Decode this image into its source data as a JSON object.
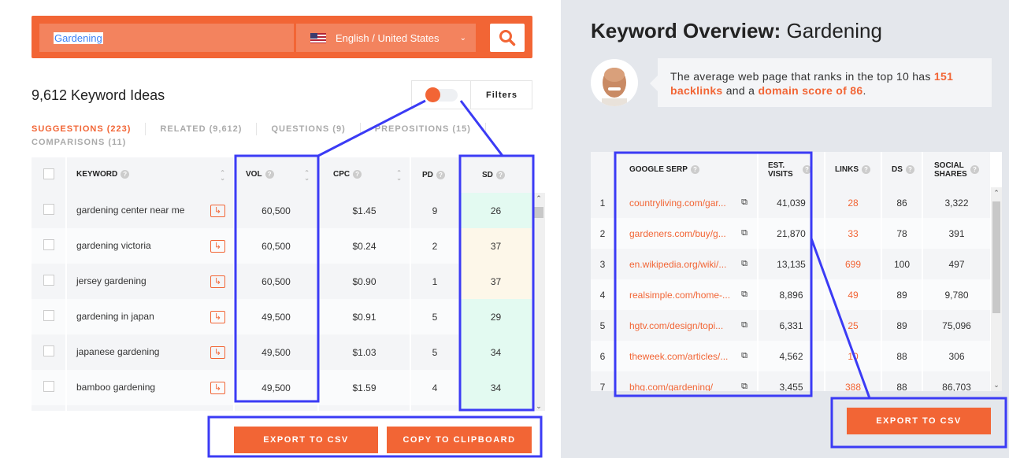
{
  "search": {
    "keyword": "Gardening",
    "language": "English / United States",
    "search_icon": "magnifier-icon",
    "flag_icon": "us-flag-icon"
  },
  "ideas_count": "9,612 Keyword Ideas",
  "filters_label": "Filters",
  "tabs": [
    {
      "label": "SUGGESTIONS (223)",
      "active": true
    },
    {
      "label": "RELATED (9,612)"
    },
    {
      "label": "QUESTIONS (9)"
    },
    {
      "label": "PREPOSITIONS (15)"
    },
    {
      "label": "COMPARISONS (11)"
    }
  ],
  "keywords_table": {
    "headers": [
      "KEYWORD",
      "VOL",
      "CPC",
      "PD",
      "SD"
    ],
    "rows": [
      {
        "keyword": "gardening center near me",
        "vol": "60,500",
        "cpc": "$1.45",
        "pd": "9",
        "sd": "26"
      },
      {
        "keyword": "gardening victoria",
        "vol": "60,500",
        "cpc": "$0.24",
        "pd": "2",
        "sd": "37"
      },
      {
        "keyword": "jersey gardening",
        "vol": "60,500",
        "cpc": "$0.90",
        "pd": "1",
        "sd": "37"
      },
      {
        "keyword": "gardening in japan",
        "vol": "49,500",
        "cpc": "$0.91",
        "pd": "5",
        "sd": "29"
      },
      {
        "keyword": "japanese gardening",
        "vol": "49,500",
        "cpc": "$1.03",
        "pd": "5",
        "sd": "34"
      },
      {
        "keyword": "bamboo gardening",
        "vol": "49,500",
        "cpc": "$1.59",
        "pd": "4",
        "sd": "34"
      }
    ]
  },
  "buttons": {
    "export_left": "EXPORT TO CSV",
    "copy": "COPY TO CLIPBOARD",
    "export_right": "EXPORT TO CSV"
  },
  "overview": {
    "title_bold": "Keyword Overview:",
    "title_keyword": "Gardening",
    "tip_prefix": "The average web page that ranks in the top 10 has ",
    "tip_backlinks": "151 backlinks",
    "tip_mid": " and a ",
    "tip_ds": "domain score of 86",
    "tip_end": "."
  },
  "serp_table": {
    "headers": [
      "GOOGLE SERP",
      "EST. VISITS",
      "LINKS",
      "DS",
      "SOCIAL SHARES"
    ],
    "rows": [
      {
        "rank": "1",
        "url": "countryliving.com/gar...",
        "visits": "41,039",
        "links": "28",
        "ds": "86",
        "shares": "3,322"
      },
      {
        "rank": "2",
        "url": "gardeners.com/buy/g...",
        "visits": "21,870",
        "links": "33",
        "ds": "78",
        "shares": "391"
      },
      {
        "rank": "3",
        "url": "en.wikipedia.org/wiki/...",
        "visits": "13,135",
        "links": "699",
        "ds": "100",
        "shares": "497"
      },
      {
        "rank": "4",
        "url": "realsimple.com/home-...",
        "visits": "8,896",
        "links": "49",
        "ds": "89",
        "shares": "9,780"
      },
      {
        "rank": "5",
        "url": "hgtv.com/design/topi...",
        "visits": "6,331",
        "links": "25",
        "ds": "89",
        "shares": "75,096"
      },
      {
        "rank": "6",
        "url": "theweek.com/articles/...",
        "visits": "4,562",
        "links": "10",
        "ds": "88",
        "shares": "306"
      },
      {
        "rank": "7",
        "url": "bhg.com/gardening/",
        "visits": "3,455",
        "links": "388",
        "ds": "88",
        "shares": "86,703"
      }
    ]
  },
  "colors": {
    "accent": "#f26535",
    "annotation": "#3b3bf5",
    "sd_easy": "#e3faf1",
    "sd_medium": "#fdf7e9"
  }
}
